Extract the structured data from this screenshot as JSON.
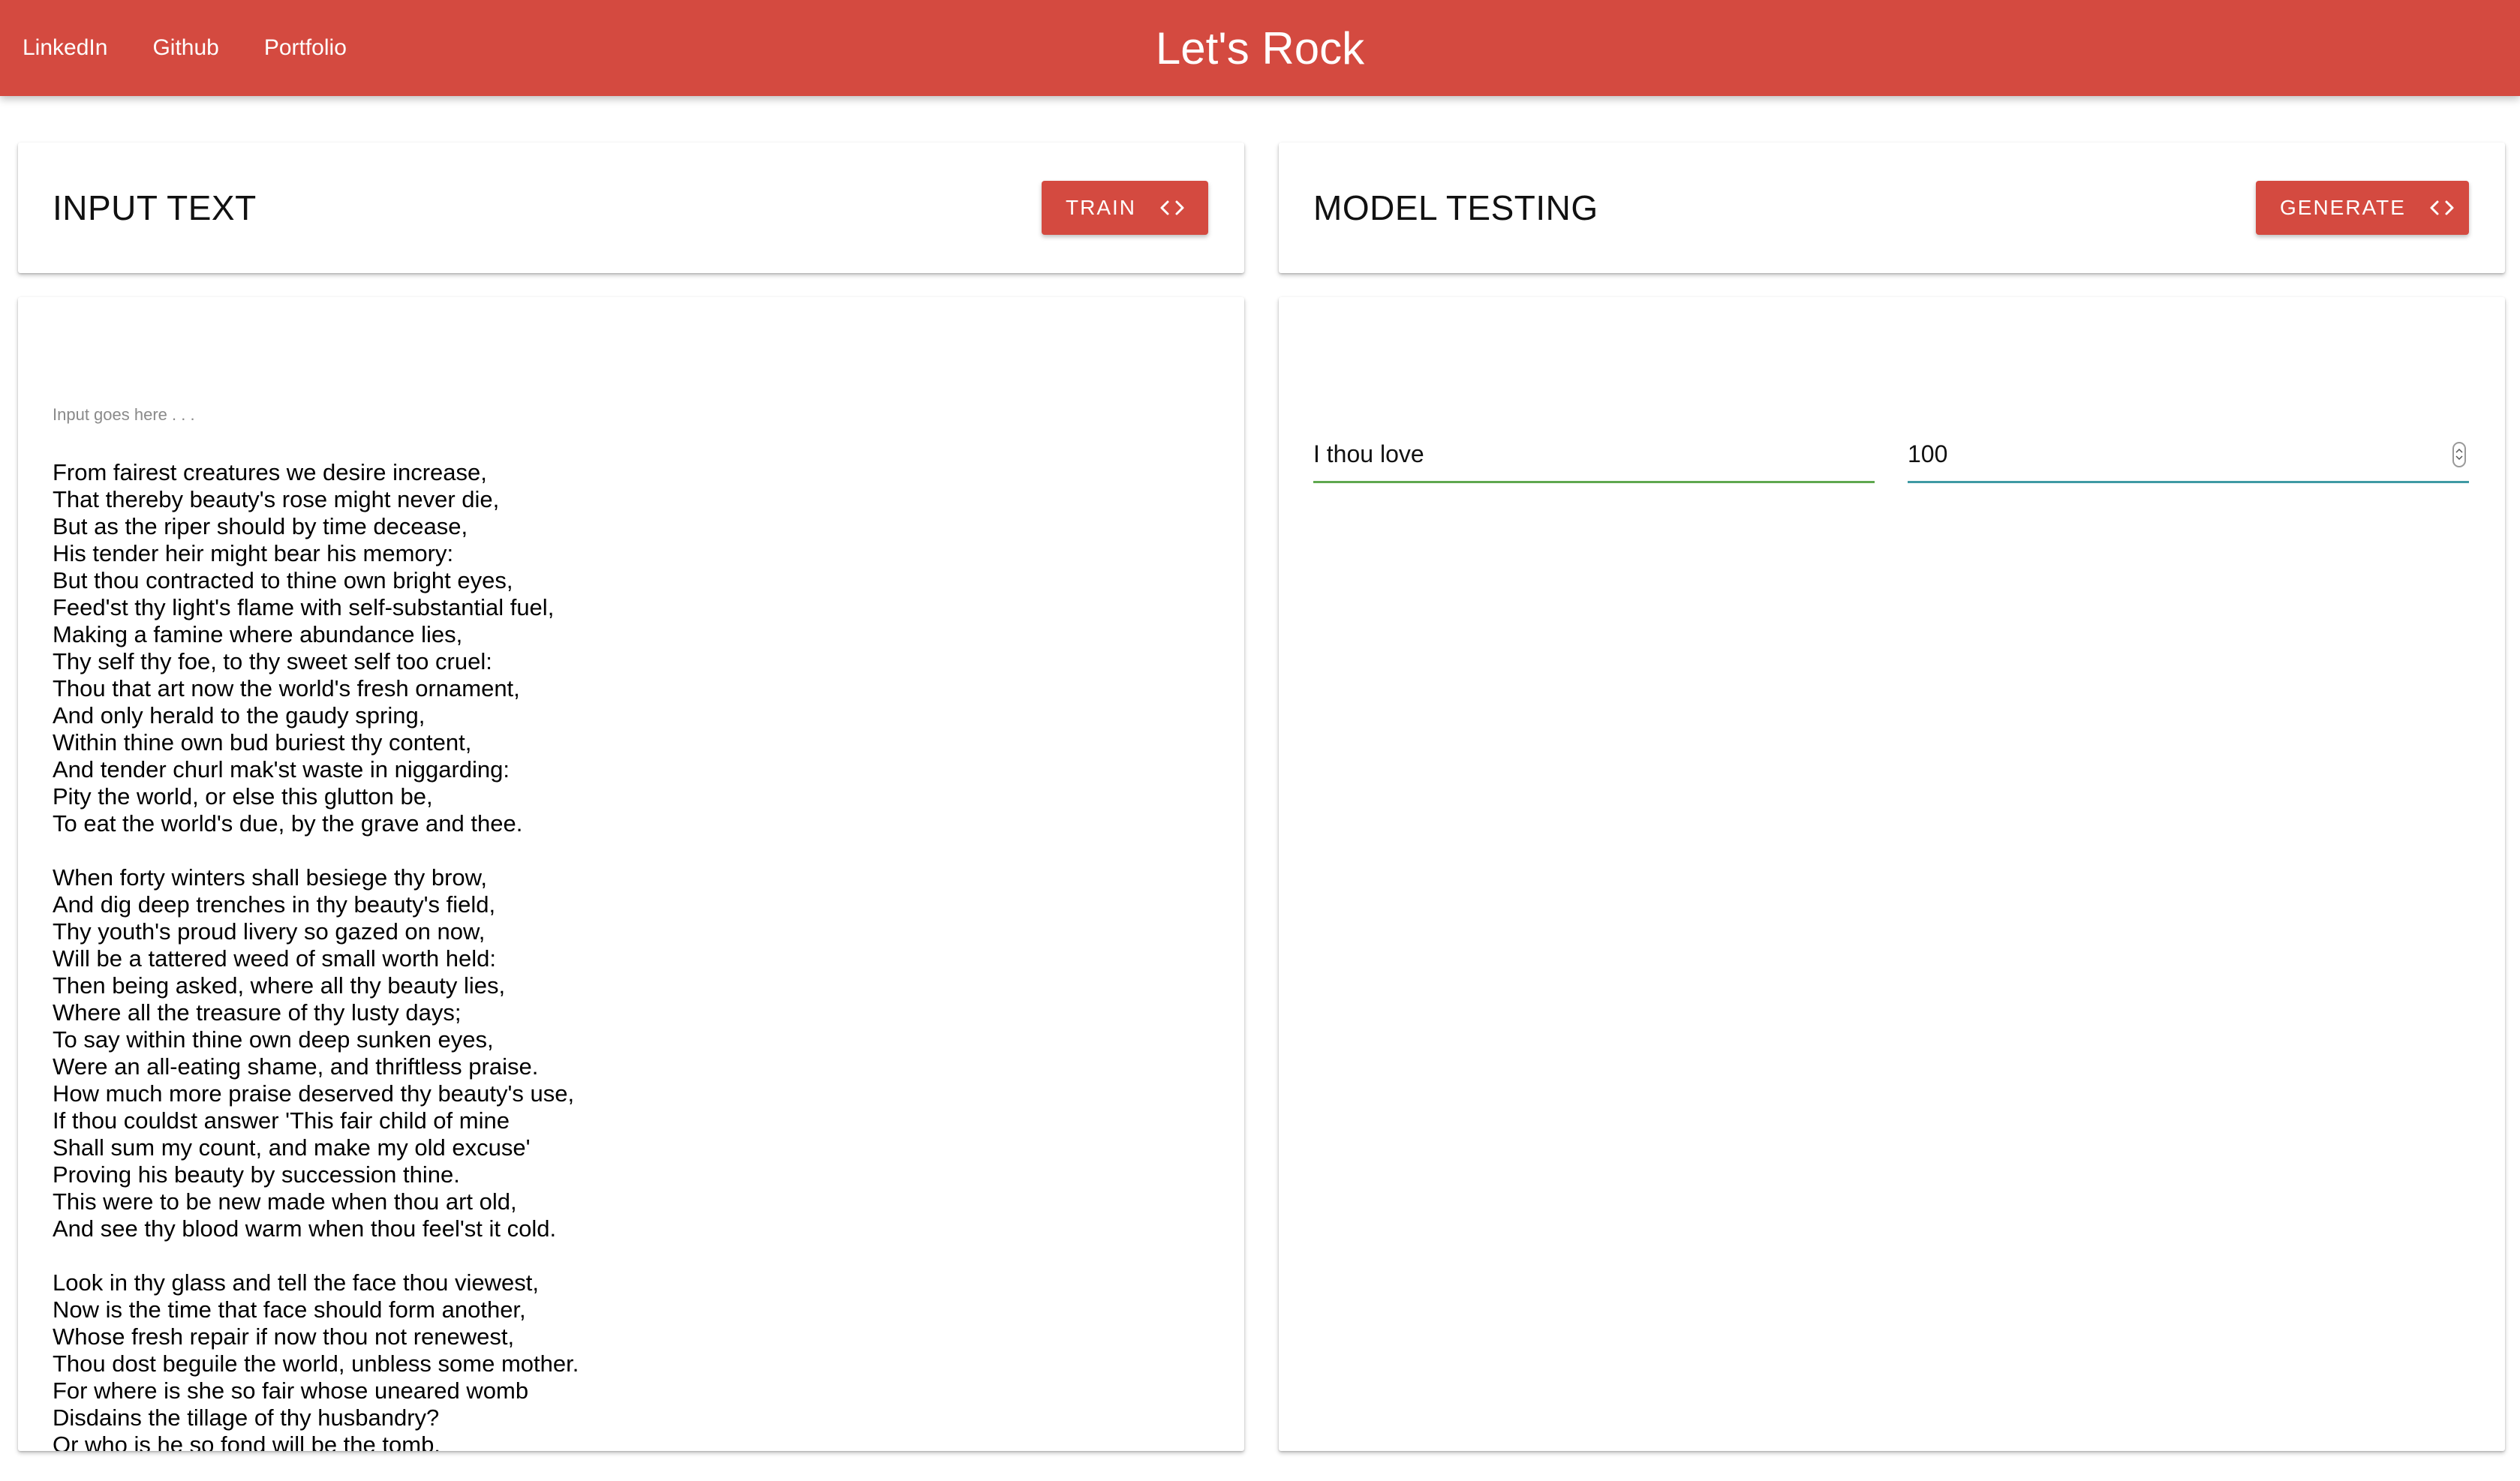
{
  "navbar": {
    "links": [
      "LinkedIn",
      "Github",
      "Portfolio"
    ],
    "brand": "Let's Rock",
    "background": "#d44a40"
  },
  "input_card": {
    "title": "INPUT TEXT",
    "button_label": "TRAIN",
    "button_icon": "code-icon",
    "placeholder": "Input goes here . . .",
    "text": "From fairest creatures we desire increase,\nThat thereby beauty's rose might never die,\nBut as the riper should by time decease,\nHis tender heir might bear his memory:\nBut thou contracted to thine own bright eyes,\nFeed'st thy light's flame with self-substantial fuel,\nMaking a famine where abundance lies,\nThy self thy foe, to thy sweet self too cruel:\nThou that art now the world's fresh ornament,\nAnd only herald to the gaudy spring,\nWithin thine own bud buriest thy content,\nAnd tender churl mak'st waste in niggarding:\nPity the world, or else this glutton be,\nTo eat the world's due, by the grave and thee.\n\nWhen forty winters shall besiege thy brow,\nAnd dig deep trenches in thy beauty's field,\nThy youth's proud livery so gazed on now,\nWill be a tattered weed of small worth held:\nThen being asked, where all thy beauty lies,\nWhere all the treasure of thy lusty days;\nTo say within thine own deep sunken eyes,\nWere an all-eating shame, and thriftless praise.\nHow much more praise deserved thy beauty's use,\nIf thou couldst answer 'This fair child of mine\nShall sum my count, and make my old excuse'\nProving his beauty by succession thine.\nThis were to be new made when thou art old,\nAnd see thy blood warm when thou feel'st it cold.\n\nLook in thy glass and tell the face thou viewest,\nNow is the time that face should form another,\nWhose fresh repair if now thou not renewest,\nThou dost beguile the world, unbless some mother.\nFor where is she so fair whose uneared womb\nDisdains the tillage of thy husbandry?\nOr who is he so fond will be the tomb,"
  },
  "model_card": {
    "title": "MODEL TESTING",
    "button_label": "GENERATE",
    "button_icon": "code-icon",
    "seed_text": "I thou love",
    "length_value": "100",
    "seed_underline_color": "#5fa84f",
    "length_underline_color": "#3f9aa4"
  }
}
